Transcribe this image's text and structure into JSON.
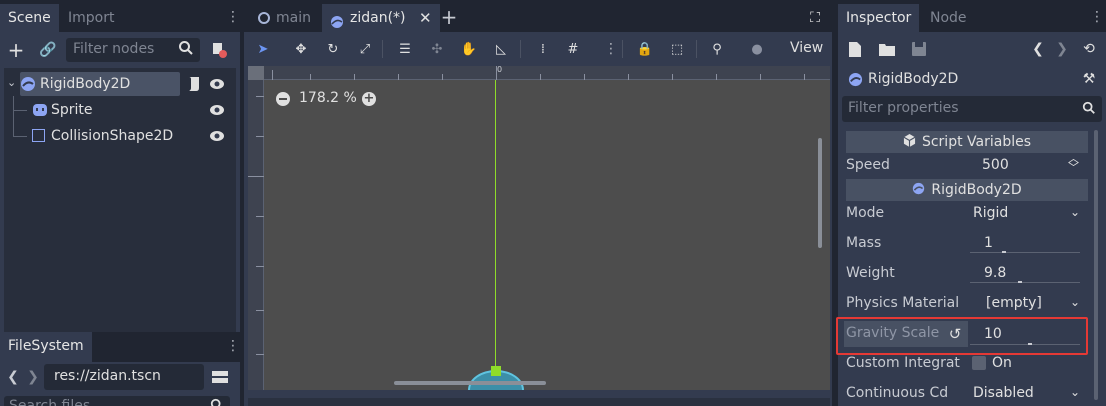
{
  "scene_dock": {
    "tabs": [
      "Scene",
      "Import"
    ],
    "filter_placeholder": "Filter nodes",
    "tree": [
      {
        "label": "RigidBody2D",
        "icon": "rigidbody-icon"
      },
      {
        "label": "Sprite",
        "icon": "sprite-icon"
      },
      {
        "label": "CollisionShape2D",
        "icon": "collision-shape-icon"
      }
    ]
  },
  "filesystem_dock": {
    "tab": "FileSystem",
    "path": "res://zidan.tscn",
    "search_placeholder": "Search files"
  },
  "editor": {
    "tabs": [
      "main",
      "zidan(*)"
    ],
    "view_menu": "View",
    "zoom_label": "178.2 %",
    "ruler_zero": "0"
  },
  "inspector": {
    "tabs": [
      "Inspector",
      "Node"
    ],
    "node_name": "RigidBody2D",
    "filter_placeholder": "Filter properties",
    "script_section": "Script Variables",
    "class_section": "RigidBody2D",
    "properties": {
      "speed_label": "Speed",
      "speed_value": "500",
      "mode_label": "Mode",
      "mode_value": "Rigid",
      "mass_label": "Mass",
      "mass_value": "1",
      "weight_label": "Weight",
      "weight_value": "9.8",
      "physics_material_label": "Physics Material",
      "physics_material_value": "[empty]",
      "gravity_scale_label": "Gravity Scale",
      "gravity_scale_value": "10",
      "custom_integrator_label": "Custom Integrat",
      "custom_integrator_value": "On",
      "continuous_cd_label": "Continuous Cd",
      "continuous_cd_value": "Disabled"
    }
  },
  "colors": {
    "accent": "#6c95f2",
    "highlight_box": "#e53935",
    "viewport_bg": "#4d4d4d",
    "axis_line": "#8fdc2a"
  }
}
